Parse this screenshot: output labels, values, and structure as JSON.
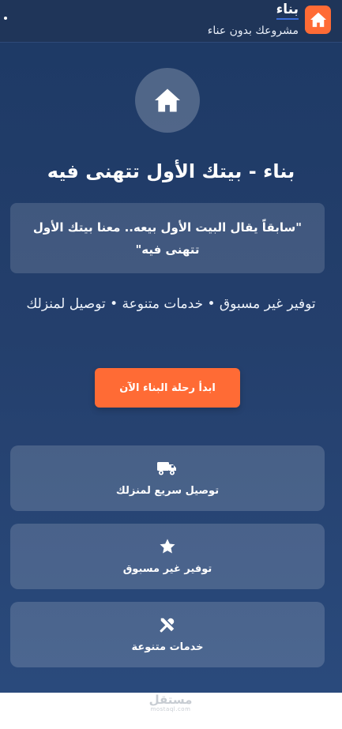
{
  "header": {
    "brand_name": "بناء",
    "tagline": "مشروعك بدون عناء",
    "logo_icon": "home-icon",
    "brand_color": "#ff6b35"
  },
  "hero": {
    "icon": "home-icon",
    "title": "بناء - بيتك الأول تتهنى فيه",
    "quote": "\"سابقاً يقال البيت الأول بيعه.. معنا بيتك الأول تتهنى فيه\"",
    "features_line": "توفير غير مسبوق • خدمات متنوعة • توصيل لمنزلك",
    "cta_label": "ابدأ رحلة البناء الآن"
  },
  "features": [
    {
      "icon": "truck-icon",
      "label": "توصيل سريع لمنزلك"
    },
    {
      "icon": "star-icon",
      "label": "توفير غير مسبوق"
    },
    {
      "icon": "tools-icon",
      "label": "خدمات متنوعة"
    }
  ],
  "watermark": {
    "line1": "مستقل",
    "line2": "mostaql.com"
  },
  "colors": {
    "navy": "#1f3559",
    "accent": "#ff6b35"
  }
}
